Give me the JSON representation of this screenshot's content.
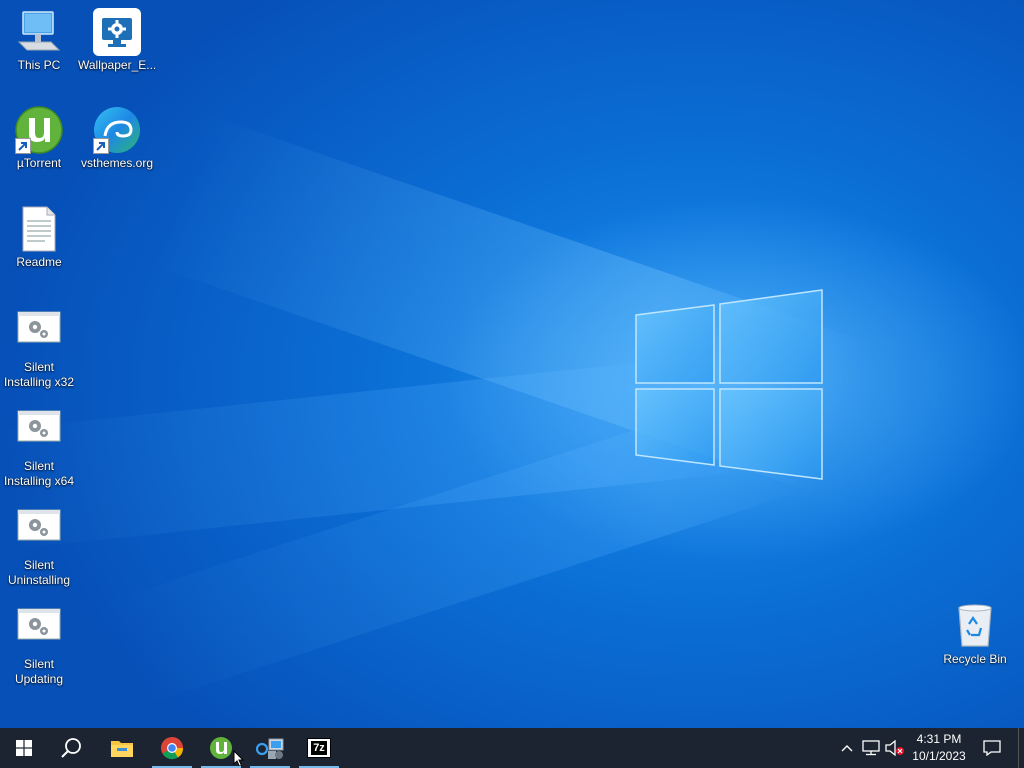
{
  "desktop": {
    "icons": [
      {
        "label": "This PC"
      },
      {
        "label": "Wallpaper_E..."
      },
      {
        "label": "µTorrent"
      },
      {
        "label": "vsthemes.org"
      },
      {
        "label": "Readme"
      },
      {
        "label": "Silent Installing x32"
      },
      {
        "label": "Silent Installing x64"
      },
      {
        "label": "Silent Uninstalling"
      },
      {
        "label": "Silent Updating"
      },
      {
        "label": "Recycle Bin"
      }
    ]
  },
  "taskbar": {
    "clock_time": "4:31 PM",
    "clock_date": "10/1/2023",
    "seven_zip_label": "7z",
    "accent_color": "#76b9ed",
    "background_color": "#1b2430"
  }
}
